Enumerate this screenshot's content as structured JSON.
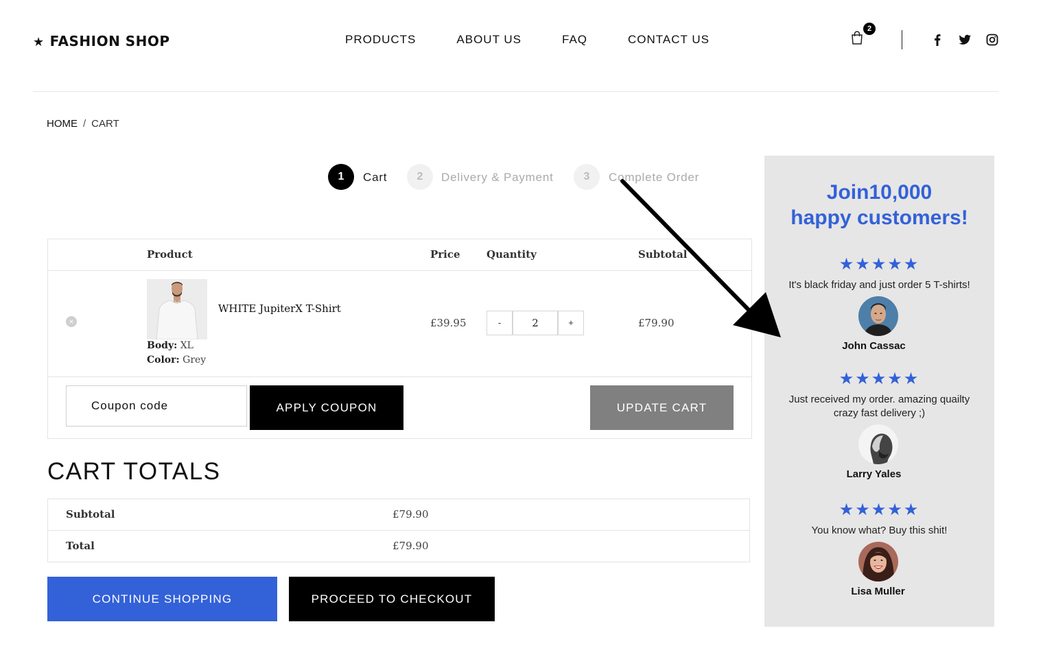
{
  "header": {
    "logo_star": "★",
    "logo_text": "FASHION SHOP",
    "nav": [
      "PRODUCTS",
      "ABOUT US",
      "FAQ",
      "CONTACT US"
    ],
    "cart_count": "2",
    "icons": [
      "shopping-bag-icon",
      "facebook-icon",
      "twitter-icon",
      "instagram-icon"
    ]
  },
  "breadcrumb": {
    "home": "HOME",
    "separator": "/",
    "current": "CART"
  },
  "steps": [
    {
      "number": "1",
      "label": "Cart"
    },
    {
      "number": "2",
      "label": "Delivery & Payment"
    },
    {
      "number": "3",
      "label": "Complete Order"
    }
  ],
  "cart": {
    "columns": {
      "product": "Product",
      "price": "Price",
      "quantity": "Quantity",
      "subtotal": "Subtotal"
    },
    "item": {
      "remove_icon": "×",
      "name": "WHITE JupiterX T-Shirt",
      "body_label": "Body:",
      "body_value": "XL",
      "color_label": "Color:",
      "color_value": "Grey",
      "price": "£39.95",
      "quantity": "2",
      "subtotal": "£79.90",
      "minus": "-",
      "plus": "+"
    },
    "coupon_placeholder": "Coupon code",
    "apply_coupon": "APPLY COUPON",
    "update_cart": "UPDATE CART"
  },
  "totals": {
    "title": "CART TOTALS",
    "subtotal_label": "Subtotal",
    "subtotal_value": "£79.90",
    "total_label": "Total",
    "total_value": "£79.90",
    "continue_shopping": "CONTINUE SHOPPING",
    "proceed_checkout": "PROCEED TO CHECKOUT"
  },
  "testimonials": {
    "title_line1": "Join10,000",
    "title_line2": "happy customers!",
    "reviews": [
      {
        "stars": "★★★★★",
        "rating": 5,
        "quote": "It's black friday and just order 5 T-shirts!",
        "name": "John Cassac"
      },
      {
        "stars": "★★★★★",
        "rating": 5,
        "quote_line1": "Just received my order. amazing quailty",
        "quote_line2": "crazy fast delivery ;)",
        "name": "Larry Yales"
      },
      {
        "stars": "★★★★★",
        "rating": 5,
        "quote": "You know what? Buy this shit!",
        "name": "Lisa Muller"
      }
    ]
  },
  "colors": {
    "accent_blue": "#3361d8",
    "black": "#000000",
    "grey_button": "#808080",
    "panel_bg": "#e6e6e6"
  }
}
